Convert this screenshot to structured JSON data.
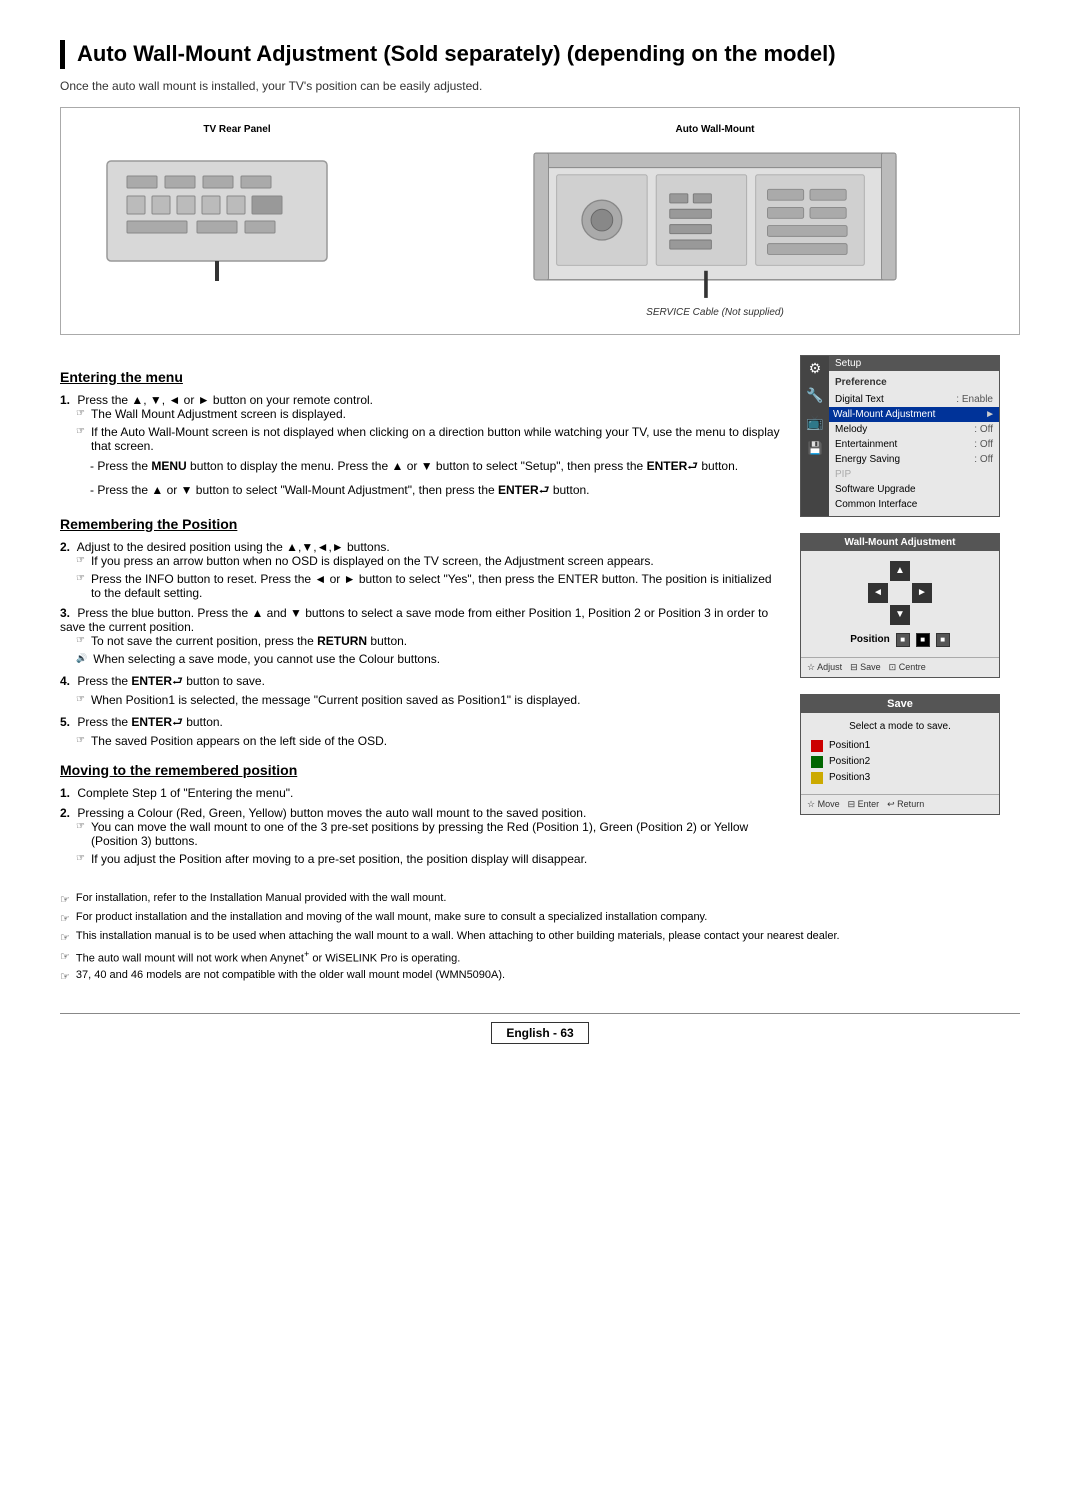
{
  "page": {
    "title": "Auto Wall-Mount Adjustment (Sold separately) (depending on the model)",
    "subtitle": "Once the auto wall mount is installed, your TV's position can be easily adjusted.",
    "diagram": {
      "left_label": "TV Rear Panel",
      "right_label": "Auto Wall-Mount",
      "service_label": "SERVICE Cable (Not supplied)"
    },
    "sections": {
      "entering_menu": {
        "heading": "Entering the menu",
        "step1": "Press the ▲, ▼, ◄ or ► button on your remote control.",
        "note1": "The Wall Mount Adjustment screen is displayed.",
        "note2": "If the Auto Wall-Mount screen is not displayed when clicking on a direction button while watching your TV, use the menu to display that screen.",
        "dash1": "Press the MENU button to display the menu. Press the ▲ or ▼ button to select \"Setup\", then press the ENTER button.",
        "dash2": "Press the ▲ or ▼ button to select \"Wall-Mount Adjustment\", then press the ENTER button."
      },
      "remembering_position": {
        "heading": "Remembering the Position",
        "step2": "Adjust to the desired position using the ▲,▼,◄,► buttons.",
        "note3": "If you press an arrow button when no OSD is displayed on the TV screen, the Adjustment screen appears.",
        "note4": "Press the INFO button to reset. Press the ◄ or ► button to select \"Yes\", then press the ENTER button. The position is initialized to the default setting.",
        "step3": "Press the blue button. Press the ▲ and ▼ buttons to select a save mode from either Position 1, Position 2 or Position 3 in order to save the current position.",
        "note5": "To not save the current position, press the RETURN button.",
        "note6": "When selecting a save mode, you cannot use the Colour buttons.",
        "step4": "Press the ENTER button to save.",
        "note7": "When Position1 is selected, the message \"Current position saved as Position1\" is displayed.",
        "step5": "Press the ENTER button.",
        "note8": "The saved Position appears on the left side of the OSD."
      },
      "moving_position": {
        "heading": "Moving to the remembered position",
        "step1": "Complete Step 1 of \"Entering the menu\".",
        "step2": "Pressing a Colour (Red, Green, Yellow) button moves the auto wall mount to the saved position.",
        "note1": "You can move the wall mount to one of the 3 pre-set positions by pressing the Red (Position 1), Green (Position 2) or Yellow (Position 3) buttons.",
        "note2": "If you adjust the Position after moving to a pre-set position, the position display will disappear."
      }
    },
    "bottom_notes": [
      "For installation, refer to the Installation Manual provided with the wall mount.",
      "For product installation and the installation and moving of the wall mount, make sure to consult a specialized installation company.",
      "This installation manual is to be used when attaching the wall mount to a wall. When attaching to other building materials, please contact your nearest dealer.",
      "The auto wall mount will not work when Anynet+ or WiSELINK Pro is operating.",
      "37, 40 and 46 models are not compatible with the older wall mount model (WMN5090A)."
    ],
    "setup_panel": {
      "title": "Preference",
      "tab": "Setup",
      "items": [
        {
          "name": "Digital Text",
          "value": ": Enable"
        },
        {
          "name": "Wall-Mount Adjustment",
          "value": "►",
          "highlighted": true
        },
        {
          "name": "Melody",
          "value": ": Off"
        },
        {
          "name": "Entertainment",
          "value": ": Off"
        },
        {
          "name": "Energy Saving",
          "value": ": Off"
        },
        {
          "name": "PIP",
          "value": ""
        },
        {
          "name": "Software Upgrade",
          "value": ""
        },
        {
          "name": "Common Interface",
          "value": ""
        }
      ]
    },
    "wma_panel": {
      "title": "Wall-Mount Adjustment",
      "position_label": "Position",
      "positions": [
        "1",
        "2",
        "3"
      ],
      "footer": [
        "☆ Adjust",
        "⊟ Save",
        "⊡ Centre"
      ]
    },
    "save_panel": {
      "title": "Save",
      "select_label": "Select a mode to save.",
      "options": [
        {
          "label": "Position1",
          "color": "red"
        },
        {
          "label": "Position2",
          "color": "green"
        },
        {
          "label": "Position3",
          "color": "yellow"
        }
      ],
      "footer": [
        "☆ Move",
        "⊟ Enter",
        "↩ Return"
      ]
    },
    "footer": {
      "language": "English",
      "page": "63",
      "label": "English - 63"
    }
  }
}
